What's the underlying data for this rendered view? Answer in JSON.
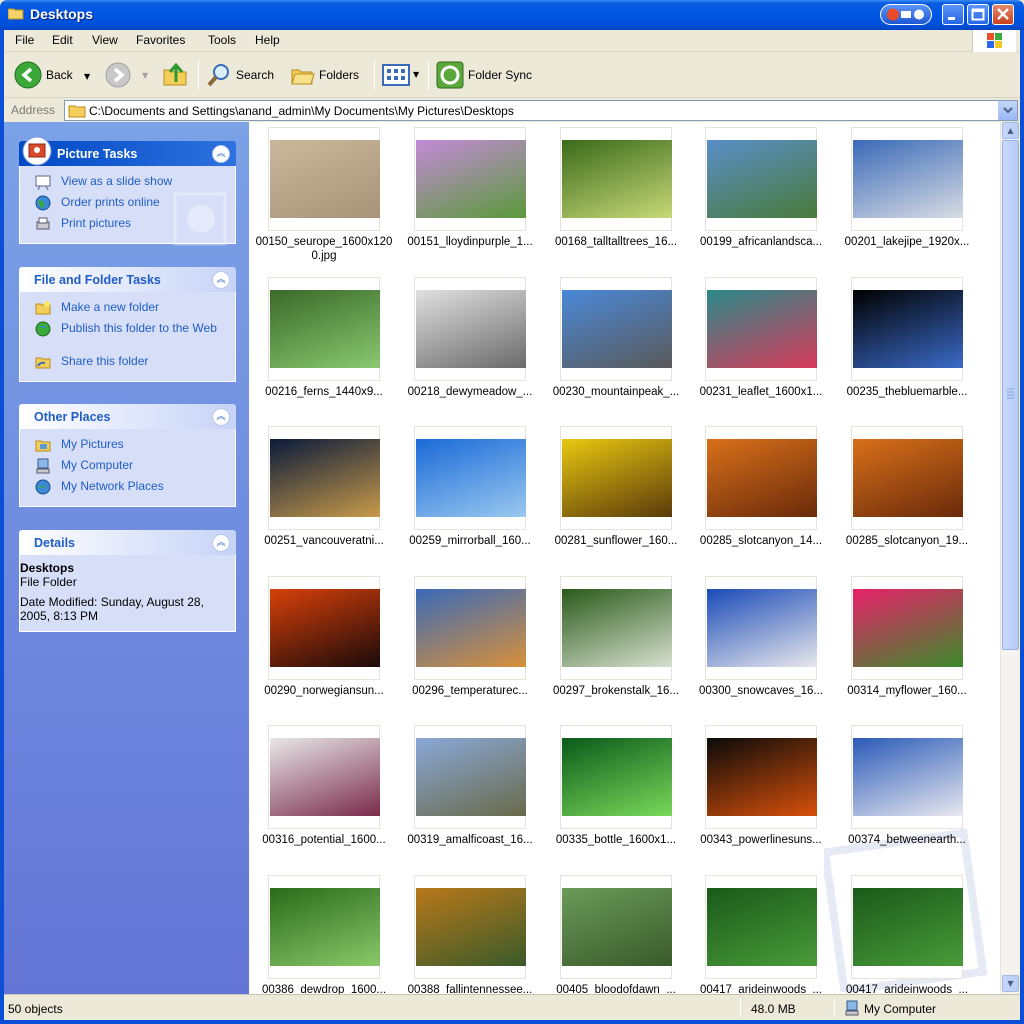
{
  "window": {
    "title": "Desktops"
  },
  "menu": [
    "File",
    "Edit",
    "View",
    "Favorites",
    "Tools",
    "Help"
  ],
  "toolbar": {
    "back_label": "Back",
    "search_label": "Search",
    "folders_label": "Folders",
    "folder_sync_label": "Folder Sync"
  },
  "address": {
    "label": "Address",
    "path": "C:\\Documents and Settings\\anand_admin\\My Documents\\My Pictures\\Desktops"
  },
  "task_pane": {
    "picture_tasks": {
      "title": "Picture Tasks",
      "items": [
        "View as a slide show",
        "Order prints online",
        "Print pictures"
      ]
    },
    "file_folder_tasks": {
      "title": "File and Folder Tasks",
      "items": [
        "Make a new folder",
        "Publish this folder to the Web",
        "Share this folder"
      ]
    },
    "other_places": {
      "title": "Other Places",
      "items": [
        "My Pictures",
        "My Computer",
        "My Network Places"
      ]
    },
    "details": {
      "title": "Details",
      "name": "Desktops",
      "type": "File Folder",
      "modified": "Date Modified: Sunday, August 28, 2005, 8:13 PM"
    }
  },
  "files": [
    {
      "caption": "00150_seurope_1600x1200.jpg",
      "colors": [
        "#c8b89c",
        "#a89478"
      ]
    },
    {
      "caption": "00151_lloydinpurple_1...",
      "colors": [
        "#c48ad8",
        "#5a9a3a"
      ]
    },
    {
      "caption": "00168_talltalltrees_16...",
      "colors": [
        "#3a6a1a",
        "#c8d878"
      ]
    },
    {
      "caption": "00199_africanlandsca...",
      "colors": [
        "#5a8ec8",
        "#4a7a3a"
      ]
    },
    {
      "caption": "00201_lakejipe_1920x...",
      "colors": [
        "#3a6ab8",
        "#d8dce4"
      ]
    },
    {
      "caption": "00216_ferns_1440x9...",
      "colors": [
        "#3a6a2a",
        "#8ac870"
      ]
    },
    {
      "caption": "00218_dewymeadow_...",
      "colors": [
        "#e0e0e0",
        "#6a6a6a"
      ]
    },
    {
      "caption": "00230_mountainpeak_...",
      "colors": [
        "#4a88d8",
        "#5a5a5a"
      ]
    },
    {
      "caption": "00231_leaflet_1600x1...",
      "colors": [
        "#2a8a8a",
        "#d83a5a"
      ]
    },
    {
      "caption": "00235_thebluemarble...",
      "colors": [
        "#000000",
        "#3a6ac8"
      ]
    },
    {
      "caption": "00251_vancouveratni...",
      "colors": [
        "#0a1a3a",
        "#c89a4a"
      ]
    },
    {
      "caption": "00259_mirrorball_160...",
      "colors": [
        "#1a6ad8",
        "#9ac8f0"
      ]
    },
    {
      "caption": "00281_sunflower_160...",
      "colors": [
        "#e8c810",
        "#5a3a0a"
      ]
    },
    {
      "caption": "00285_slotcanyon_14...",
      "colors": [
        "#d8701a",
        "#6a2a0a"
      ]
    },
    {
      "caption": "00285_slotcanyon_19...",
      "colors": [
        "#d8701a",
        "#6a2a0a"
      ]
    },
    {
      "caption": "00290_norwegiansun...",
      "colors": [
        "#d8400a",
        "#1a0a0a"
      ]
    },
    {
      "caption": "00296_temperaturec...",
      "colors": [
        "#3a6ab8",
        "#d8903a"
      ]
    },
    {
      "caption": "00297_brokenstalk_16...",
      "colors": [
        "#2a5a1a",
        "#d8e0d0"
      ]
    },
    {
      "caption": "00300_snowcaves_16...",
      "colors": [
        "#1a4ab8",
        "#e8e8ec"
      ]
    },
    {
      "caption": "00314_myflower_160...",
      "colors": [
        "#e8206a",
        "#3a8a2a"
      ]
    },
    {
      "caption": "00316_potential_1600...",
      "colors": [
        "#e8e8e8",
        "#7a2a4a"
      ]
    },
    {
      "caption": "00319_amalficoast_16...",
      "colors": [
        "#8aa8d8",
        "#6a6a4a"
      ]
    },
    {
      "caption": "00335_bottle_1600x1...",
      "colors": [
        "#0a5a1a",
        "#7ad85a"
      ]
    },
    {
      "caption": "00343_powerlinesuns...",
      "colors": [
        "#0a0a0a",
        "#d8500a"
      ]
    },
    {
      "caption": "00374_betweenearth...",
      "colors": [
        "#2a5ab8",
        "#e8e8f0"
      ]
    },
    {
      "caption": "00386_dewdrop_1600...",
      "colors": [
        "#2a6a1a",
        "#8ac86a"
      ]
    },
    {
      "caption": "00388_fallintennessee...",
      "colors": [
        "#b8781a",
        "#3a5a2a"
      ]
    },
    {
      "caption": "00405_bloodofdawn_...",
      "colors": [
        "#6a9a5a",
        "#3a5a2a"
      ]
    },
    {
      "caption": "00417_arideinwoods_...",
      "colors": [
        "#1a5a1a",
        "#4a9a3a"
      ]
    },
    {
      "caption": "00417_arideinwoods_...",
      "colors": [
        "#1a5a1a",
        "#4a9a3a"
      ]
    }
  ],
  "status": {
    "objects": "50 objects",
    "size": "48.0 MB",
    "zone": "My Computer"
  }
}
